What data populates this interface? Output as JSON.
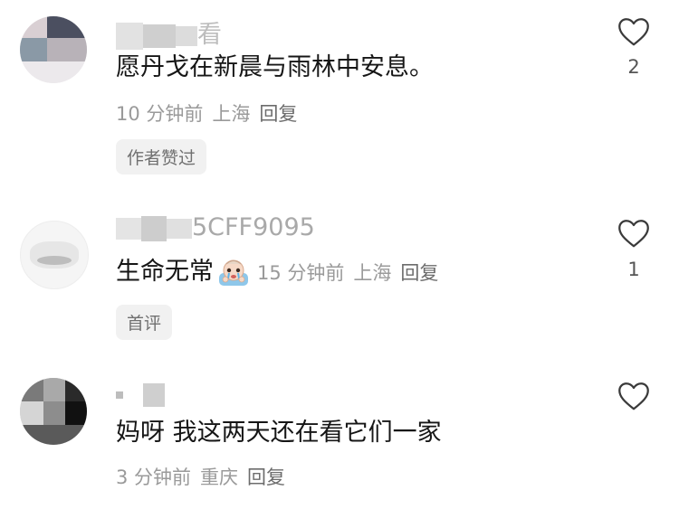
{
  "comments": [
    {
      "text": "愿丹戈在新晨与雨林中安息。",
      "time": "10 分钟前",
      "location": "上海",
      "reply": "回复",
      "tag": "作者赞过",
      "likes": "2",
      "username_partial": "看"
    },
    {
      "text": "生命无常",
      "time": "15 分钟前",
      "location": "上海",
      "reply": "回复",
      "tag": "首评",
      "likes": "1",
      "username_partial": "5CFF9095"
    },
    {
      "text": "妈呀 我这两天还在看它们一家",
      "time": "3 分钟前",
      "location": "重庆",
      "reply": "回复",
      "likes": ""
    }
  ],
  "icons": {
    "like": "heart-outline-icon",
    "emoji": "crying-emoji-icon"
  },
  "colors": {
    "text": "#161616",
    "meta": "#9a9a9a",
    "tag_bg": "#f1f1f1"
  }
}
